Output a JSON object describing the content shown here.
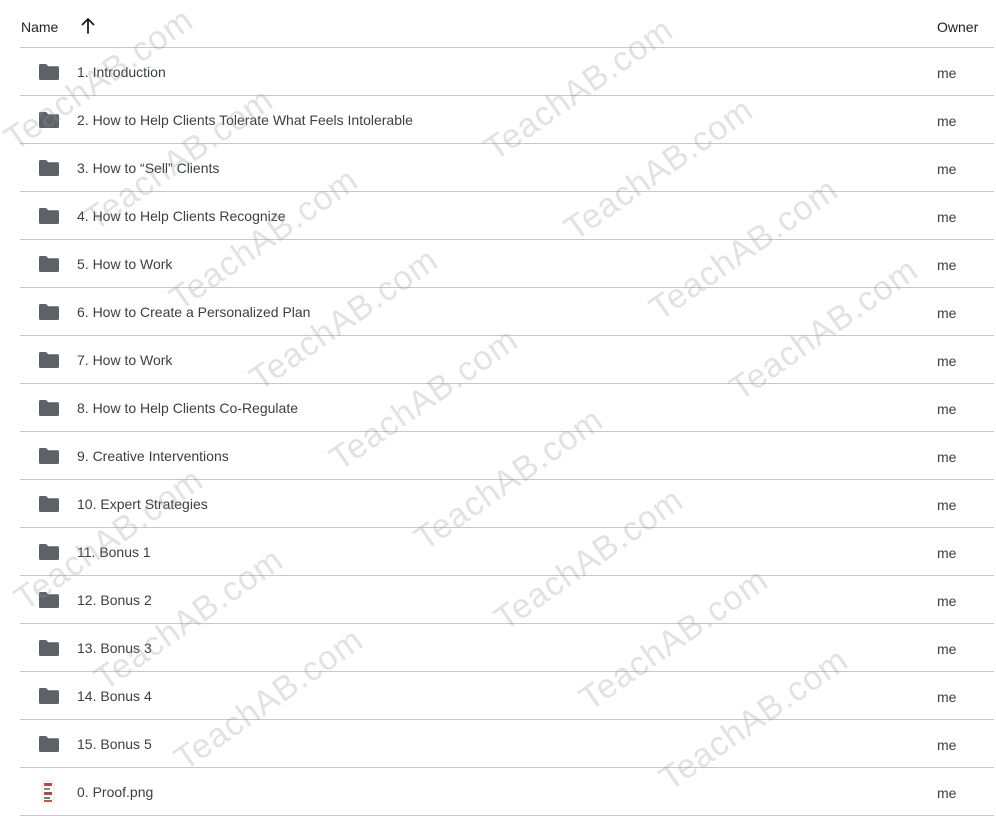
{
  "header": {
    "name_label": "Name",
    "owner_label": "Owner",
    "sort_icon": "arrow-up-icon"
  },
  "files": [
    {
      "name": "1. Introduction",
      "owner": "me",
      "type": "folder"
    },
    {
      "name": "2. How to Help Clients Tolerate What Feels Intolerable",
      "owner": "me",
      "type": "folder"
    },
    {
      "name": "3. How to “Sell” Clients",
      "owner": "me",
      "type": "folder"
    },
    {
      "name": "4. How to Help Clients Recognize",
      "owner": "me",
      "type": "folder"
    },
    {
      "name": "5. How to Work",
      "owner": "me",
      "type": "folder"
    },
    {
      "name": "6. How to Create a Personalized Plan",
      "owner": "me",
      "type": "folder"
    },
    {
      "name": "7. How to Work",
      "owner": "me",
      "type": "folder"
    },
    {
      "name": "8. How to Help Clients Co-Regulate",
      "owner": "me",
      "type": "folder"
    },
    {
      "name": "9. Creative Interventions",
      "owner": "me",
      "type": "folder"
    },
    {
      "name": "10. Expert Strategies",
      "owner": "me",
      "type": "folder"
    },
    {
      "name": "11. Bonus 1",
      "owner": "me",
      "type": "folder"
    },
    {
      "name": "12. Bonus 2",
      "owner": "me",
      "type": "folder"
    },
    {
      "name": "13. Bonus 3",
      "owner": "me",
      "type": "folder"
    },
    {
      "name": "14. Bonus 4",
      "owner": "me",
      "type": "folder"
    },
    {
      "name": "15. Bonus 5",
      "owner": "me",
      "type": "folder"
    },
    {
      "name": "0. Proof.png",
      "owner": "me",
      "type": "image"
    }
  ],
  "watermark": {
    "text": "TeachAB.com"
  },
  "colors": {
    "folder_icon": "#5f6368",
    "divider": "#c7c7c7"
  }
}
